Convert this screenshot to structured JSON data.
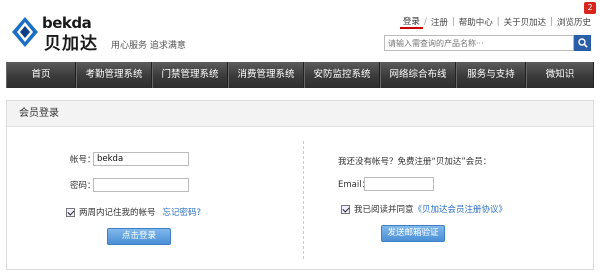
{
  "header": {
    "logo_en": "bekda",
    "logo_cn": "贝加达",
    "slogan": "用心服务  追求满意",
    "notification_count": "2",
    "top_links": [
      "登录",
      "注册",
      "帮助中心",
      "关于贝加达",
      "浏览历史"
    ],
    "search_placeholder": "请输入需查询的产品名称···"
  },
  "nav": {
    "items": [
      "首页",
      "考勤管理系统",
      "门禁管理系统",
      "消费管理系统",
      "安防监控系统",
      "网络综合布线",
      "服务与支持",
      "微知识"
    ]
  },
  "panel": {
    "title": "会员登录",
    "login": {
      "account_label": "帐号：",
      "account_value": "bekda",
      "password_label": "密码：",
      "remember_label": "两周内记住我的帐号",
      "forgot_label": "忘记密码?",
      "submit_label": "点击登录"
    },
    "register": {
      "prompt": "我还没有帐号？免费注册“贝加达”会员：",
      "email_label": "Email：",
      "agree_label": "我已阅读并同意",
      "agreement_link": "《贝加达会员注册协议》",
      "submit_label": "发送邮箱验证"
    }
  },
  "colors": {
    "accent_blue": "#2a5ea8",
    "link_blue": "#2a6fc9",
    "badge_red": "#d9261c",
    "nav_dark": "#3a3a3a"
  }
}
